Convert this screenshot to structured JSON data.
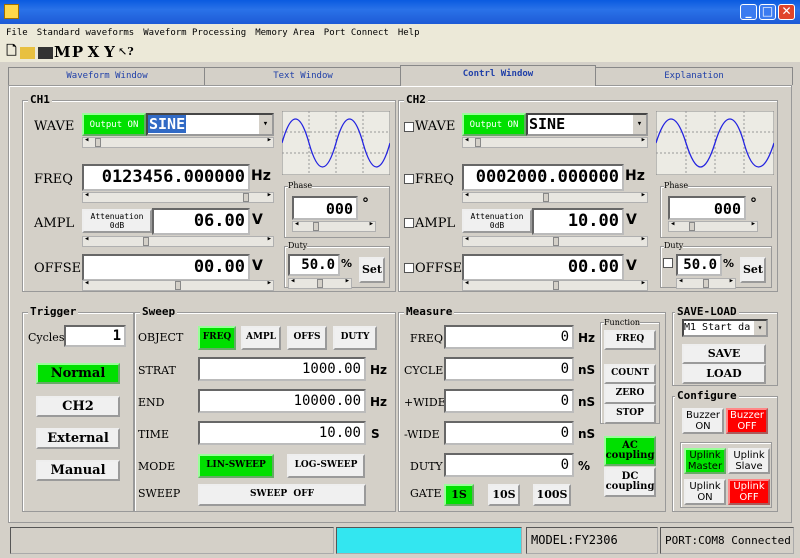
{
  "menu": [
    "File",
    "Standard waveforms",
    "Waveform Processing",
    "Memory Area",
    "Port Connect",
    "Help"
  ],
  "toolbar": [
    "M",
    "P",
    "X",
    "Y"
  ],
  "tabs": [
    "Waveform Window",
    "Text Window",
    "Contrl Window",
    "Explanation"
  ],
  "ch1": {
    "title": "CH1",
    "wave_label": "WAVE",
    "output_label": "Output ON",
    "wave_value": "SINE",
    "freq_label": "FREQ",
    "freq_value": "0123456.000000",
    "freq_unit": "Hz",
    "ampl_label": "AMPL",
    "atten_label": "Attenuation",
    "atten_value": "0dB",
    "ampl_value": "06.00",
    "ampl_unit": "V",
    "offse_label": "OFFSE",
    "offse_value": "00.00",
    "offse_unit": "V",
    "phase_label": "Phase",
    "phase_value": "000",
    "phase_unit": "°",
    "duty_label": "Duty",
    "duty_value": "50.0",
    "duty_unit": "%",
    "set_label": "Set"
  },
  "ch2": {
    "title": "CH2",
    "wave_label": "WAVE",
    "output_label": "Output ON",
    "wave_value": "SINE",
    "freq_label": "FREQ",
    "freq_value": "0002000.000000",
    "freq_unit": "Hz",
    "ampl_label": "AMPL",
    "atten_label": "Attenuation",
    "atten_value": "0dB",
    "ampl_value": "10.00",
    "ampl_unit": "V",
    "offse_label": "OFFSE",
    "offse_value": "00.00",
    "offse_unit": "V",
    "phase_label": "Phase",
    "phase_value": "000",
    "phase_unit": "°",
    "duty_label": "Duty",
    "duty_value": "50.0",
    "duty_unit": "%",
    "set_label": "Set"
  },
  "trigger": {
    "title": "Trigger",
    "cycles_label": "Cycles",
    "cycles_value": "1",
    "buttons": [
      "Normal",
      "CH2",
      "External",
      "Manual"
    ]
  },
  "sweep": {
    "title": "Sweep",
    "object_label": "OBJECT",
    "objects": [
      "FREQ",
      "AMPL",
      "OFFS",
      "DUTY"
    ],
    "strat_label": "STRAT",
    "strat_value": "1000.00",
    "strat_unit": "Hz",
    "end_label": "END",
    "end_value": "10000.00",
    "end_unit": "Hz",
    "time_label": "TIME",
    "time_value": "10.00",
    "time_unit": "S",
    "mode_label": "MODE",
    "lin_label": "LIN-SWEEP",
    "log_label": "LOG-SWEEP",
    "sweep_label": "SWEEP",
    "sweep_value": "SWEEP  OFF"
  },
  "measure": {
    "title": "Measure",
    "rows": [
      {
        "label": "FREQ",
        "value": "0",
        "unit": "Hz"
      },
      {
        "label": "CYCLE",
        "value": "0",
        "unit": "nS"
      },
      {
        "label": "+WIDE",
        "value": "0",
        "unit": "nS"
      },
      {
        "label": "-WIDE",
        "value": "0",
        "unit": "nS"
      },
      {
        "label": "DUTY",
        "value": "0",
        "unit": "%"
      }
    ],
    "gate_label": "GATE",
    "gates": [
      "1S",
      "10S",
      "100S"
    ],
    "function_label": "Function",
    "func_freq": "FREQ",
    "count": "COUNT",
    "zero": "ZERO",
    "stop": "STOP",
    "ac": "AC coupling",
    "dc": "DC coupling"
  },
  "saveload": {
    "title": "SAVE-LOAD",
    "select_value": "M1 Start da",
    "save": "SAVE",
    "load": "LOAD"
  },
  "configure": {
    "title": "Configure",
    "buzzer_on": "Buzzer ON",
    "buzzer_off": "Buzzer OFF",
    "uplink_master": "Uplink Master",
    "uplink_slave": "Uplink Slave",
    "uplink_on": "Uplink ON",
    "uplink_off": "Uplink OFF"
  },
  "status": {
    "model": "MODEL:FY2306",
    "port": "PORT:COM8 Connected"
  }
}
